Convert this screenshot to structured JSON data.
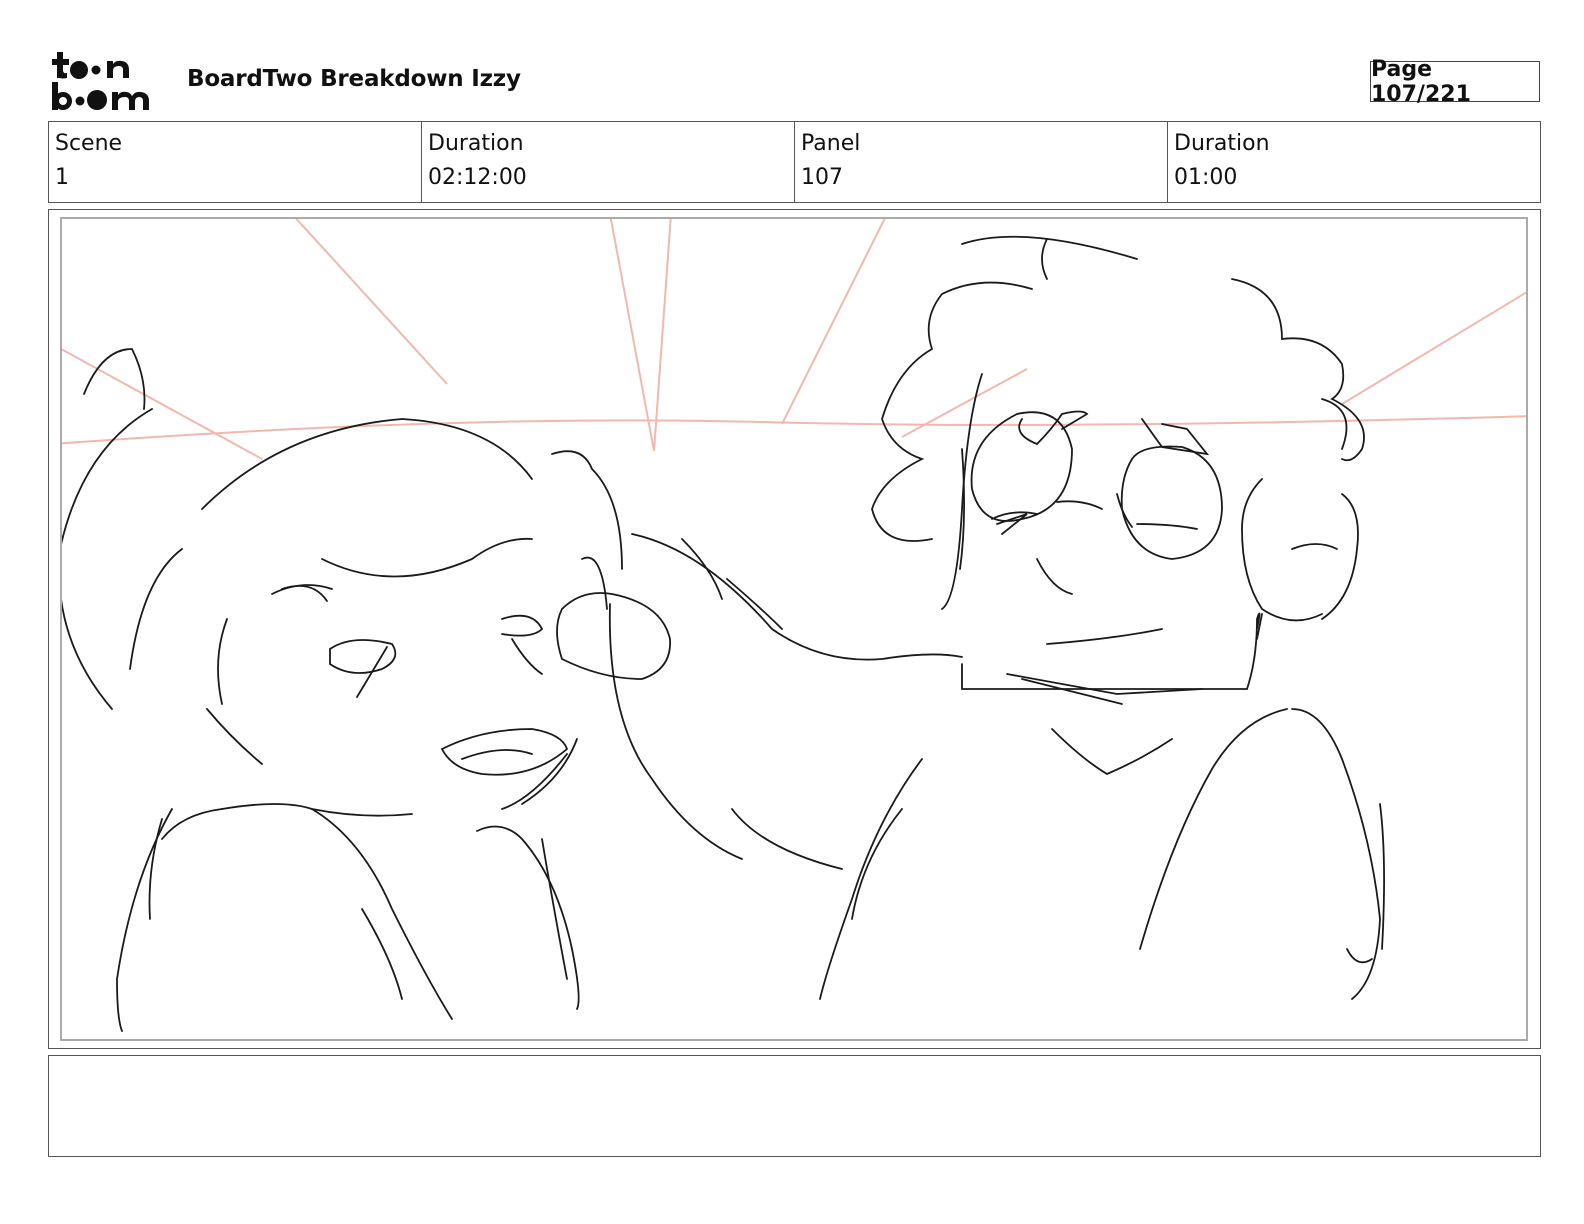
{
  "header": {
    "logo_text_line1": "toon",
    "logo_text_line2": "boom",
    "title": "BoardTwo Breakdown Izzy",
    "page_label": "Page 107/221"
  },
  "info": {
    "scene_label": "Scene",
    "scene_value": "1",
    "scene_duration_label": "Duration",
    "scene_duration_value": "02:12:00",
    "panel_label": "Panel",
    "panel_value": "107",
    "panel_duration_label": "Duration",
    "panel_duration_value": "01:00"
  },
  "caption": {
    "text": ""
  },
  "colors": {
    "sketch_line": "#1a1a1a",
    "guide_line": "#f2b8ae"
  }
}
